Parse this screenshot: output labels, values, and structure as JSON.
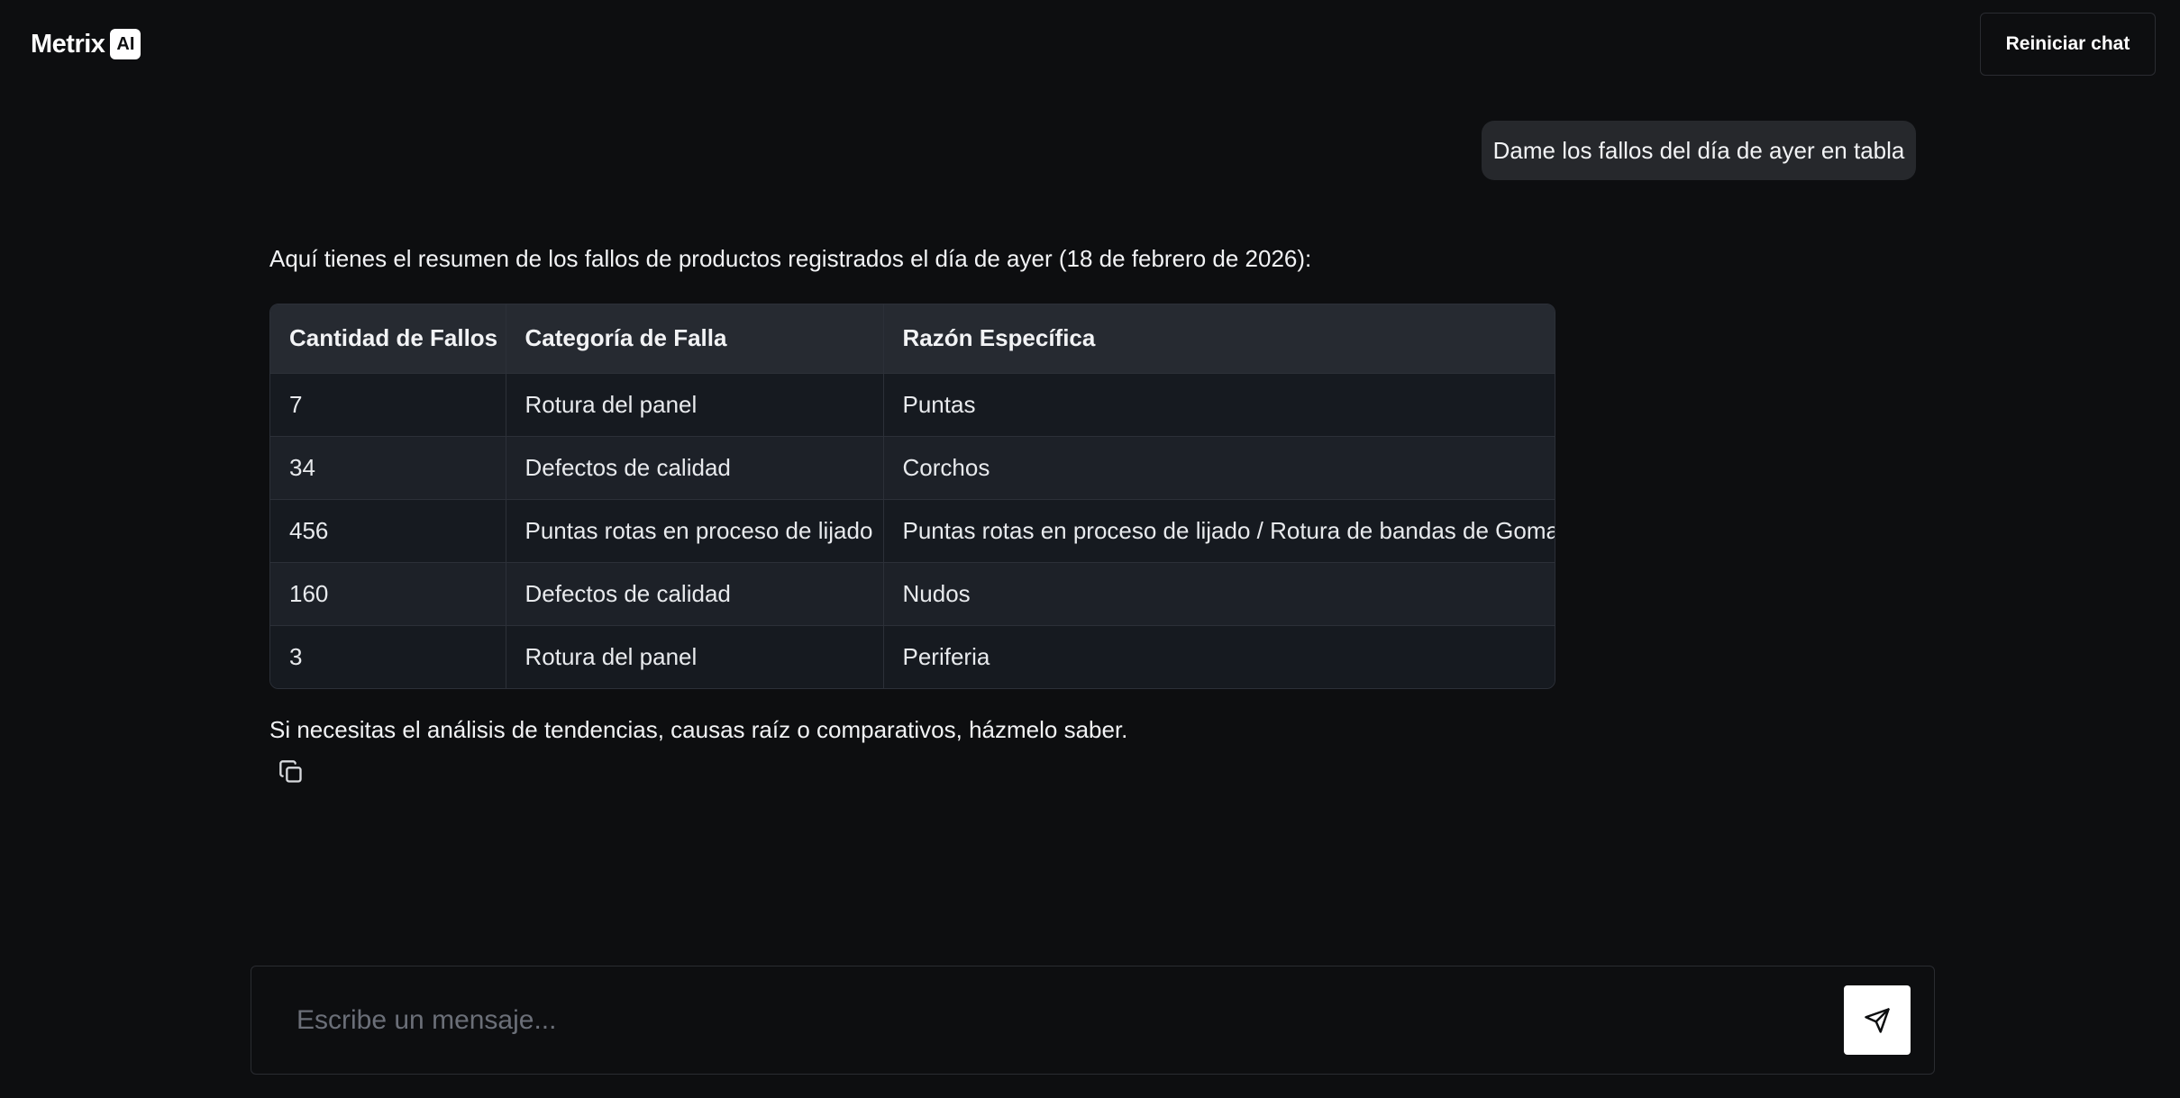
{
  "header": {
    "brand_name": "Metrix",
    "brand_badge": "AI",
    "reset_label": "Reiniciar chat"
  },
  "conversation": {
    "user_message": "Dame los fallos del día de ayer en tabla",
    "assistant": {
      "intro": "Aquí tienes el resumen de los fallos de productos registrados el día de ayer (18 de febrero de 2026):",
      "table": {
        "headers": [
          "Cantidad de Fallos",
          "Categoría de Falla",
          "Razón Específica"
        ],
        "rows": [
          [
            "7",
            "Rotura del panel",
            "Puntas"
          ],
          [
            "34",
            "Defectos de calidad",
            "Corchos"
          ],
          [
            "456",
            "Puntas rotas en proceso de lijado",
            "Puntas rotas en proceso de lijado / Rotura de bandas de Goma"
          ],
          [
            "160",
            "Defectos de calidad",
            "Nudos"
          ],
          [
            "3",
            "Rotura del panel",
            "Periferia"
          ]
        ]
      },
      "outro": "Si necesitas el análisis de tendencias, causas raíz o comparativos, házmelo saber.",
      "copy_icon": "copy-icon"
    }
  },
  "composer": {
    "placeholder": "Escribe un mensaje...",
    "value": "",
    "send_icon": "send-icon"
  },
  "colors": {
    "background": "#0d0e10",
    "user_bubble": "#26282c",
    "table_header": "#262a31",
    "table_row_odd": "#161a20",
    "table_row_even": "#1d2128",
    "send_button": "#ffffff"
  }
}
